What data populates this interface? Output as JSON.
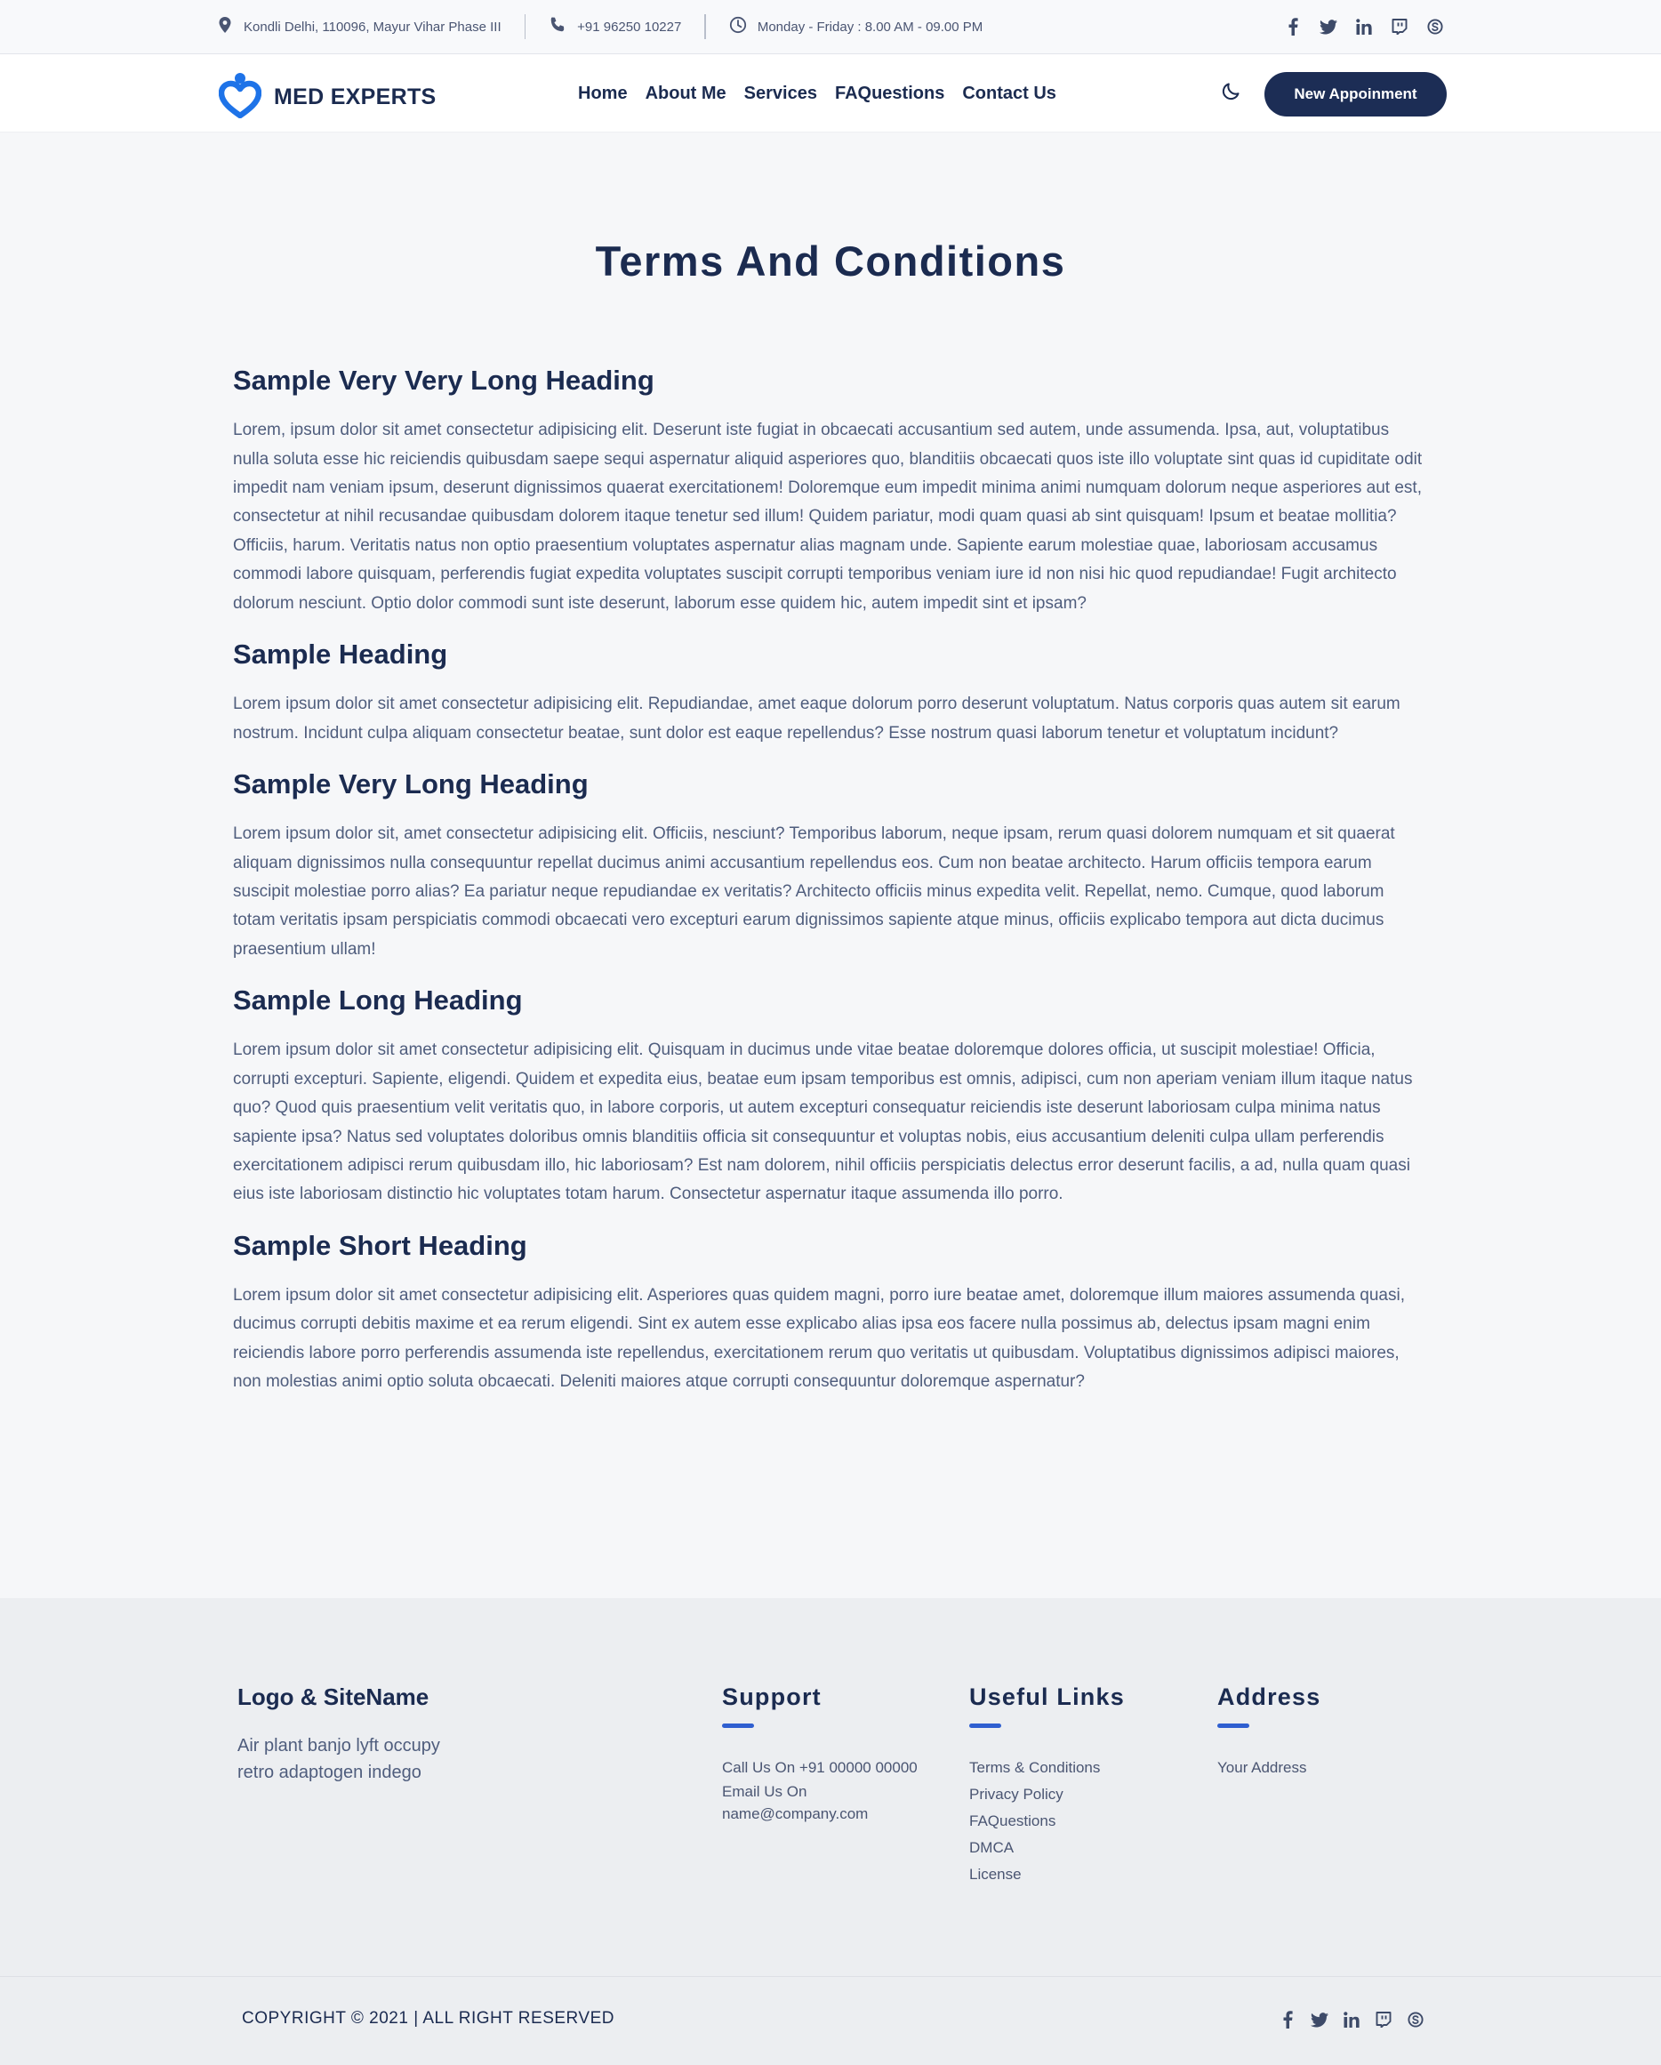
{
  "topbar": {
    "address": "Kondli Delhi, 110096, Mayur Vihar Phase III",
    "phone": "+91 96250 10227",
    "hours": "Monday - Friday : 8.00 AM - 09.00 PM",
    "socials": [
      "facebook-icon",
      "twitter-icon",
      "linkedin-icon",
      "twitch-icon",
      "skype-icon"
    ]
  },
  "navbar": {
    "logo_text": "MED EXPERTS",
    "links": [
      "Home",
      "About Me",
      "Services",
      "FAQuestions",
      "Contact Us"
    ],
    "cta_label": "New Appoinment",
    "theme_icon": "moon-icon"
  },
  "page": {
    "title": "Terms And Conditions",
    "sections": [
      {
        "heading": "Sample Very Very Long Heading",
        "body": "Lorem, ipsum dolor sit amet consectetur adipisicing elit. Deserunt iste fugiat in obcaecati accusantium sed autem, unde assumenda. Ipsa, aut, voluptatibus nulla soluta esse hic reiciendis quibusdam saepe sequi aspernatur aliquid asperiores quo, blanditiis obcaecati quos iste illo voluptate sint quas id cupiditate odit impedit nam veniam ipsum, deserunt dignissimos quaerat exercitationem! Doloremque eum impedit minima animi numquam dolorum neque asperiores aut est, consectetur at nihil recusandae quibusdam dolorem itaque tenetur sed illum! Quidem pariatur, modi quam quasi ab sint quisquam! Ipsum et beatae mollitia? Officiis, harum. Veritatis natus non optio praesentium voluptates aspernatur alias magnam unde. Sapiente earum molestiae quae, laboriosam accusamus commodi labore quisquam, perferendis fugiat expedita voluptates suscipit corrupti temporibus veniam iure id non nisi hic quod repudiandae! Fugit architecto dolorum nesciunt. Optio dolor commodi sunt iste deserunt, laborum esse quidem hic, autem impedit sint et ipsam?"
      },
      {
        "heading": "Sample Heading",
        "body": "Lorem ipsum dolor sit amet consectetur adipisicing elit. Repudiandae, amet eaque dolorum porro deserunt voluptatum. Natus corporis quas autem sit earum nostrum. Incidunt culpa aliquam consectetur beatae, sunt dolor est eaque repellendus? Esse nostrum quasi laborum tenetur et voluptatum incidunt?"
      },
      {
        "heading": "Sample Very Long Heading",
        "body": "Lorem ipsum dolor sit, amet consectetur adipisicing elit. Officiis, nesciunt? Temporibus laborum, neque ipsam, rerum quasi dolorem numquam et sit quaerat aliquam dignissimos nulla consequuntur repellat ducimus animi accusantium repellendus eos. Cum non beatae architecto. Harum officiis tempora earum suscipit molestiae porro alias? Ea pariatur neque repudiandae ex veritatis? Architecto officiis minus expedita velit. Repellat, nemo. Cumque, quod laborum totam veritatis ipsam perspiciatis commodi obcaecati vero excepturi earum dignissimos sapiente atque minus, officiis explicabo tempora aut dicta ducimus praesentium ullam!"
      },
      {
        "heading": "Sample Long Heading",
        "body": "Lorem ipsum dolor sit amet consectetur adipisicing elit. Quisquam in ducimus unde vitae beatae doloremque dolores officia, ut suscipit molestiae! Officia, corrupti excepturi. Sapiente, eligendi. Quidem et expedita eius, beatae eum ipsam temporibus est omnis, adipisci, cum non aperiam veniam illum itaque natus quo? Quod quis praesentium velit veritatis quo, in labore corporis, ut autem excepturi consequatur reiciendis iste deserunt laboriosam culpa minima natus sapiente ipsa? Natus sed voluptates doloribus omnis blanditiis officia sit consequuntur et voluptas nobis, eius accusantium deleniti culpa ullam perferendis exercitationem adipisci rerum quibusdam illo, hic laboriosam? Est nam dolorem, nihil officiis perspiciatis delectus error deserunt facilis, a ad, nulla quam quasi eius iste laboriosam distinctio hic voluptates totam harum. Consectetur aspernatur itaque assumenda illo porro."
      },
      {
        "heading": "Sample Short Heading",
        "body": "Lorem ipsum dolor sit amet consectetur adipisicing elit. Asperiores quas quidem magni, porro iure beatae amet, doloremque illum maiores assumenda quasi, ducimus corrupti debitis maxime et ea rerum eligendi. Sint ex autem esse explicabo alias ipsa eos facere nulla possimus ab, delectus ipsam magni enim reiciendis labore porro perferendis assumenda iste repellendus, exercitationem rerum quo veritatis ut quibusdam. Voluptatibus dignissimos adipisci maiores, non molestias animi optio soluta obcaecati. Deleniti maiores atque corrupti consequuntur doloremque aspernatur?"
      }
    ]
  },
  "footer": {
    "about_title": "Logo & SiteName",
    "about_text": "Air plant banjo lyft occupy retro adaptogen indego",
    "support_title": "Support",
    "support_lines": [
      "Call Us On +91 00000 00000",
      "Email Us On",
      "name@company.com"
    ],
    "links_title": "Useful Links",
    "links": [
      "Terms & Conditions",
      "Privacy Policy",
      "FAQuestions",
      "DMCA",
      "License"
    ],
    "address_title": "Address",
    "address": "Your Address",
    "copyright": "COPYRIGHT © 2021 | ALL RIGHT RESERVED"
  },
  "colors": {
    "navy": "#1c2d55",
    "accent": "#2f5fd0",
    "logo_blue": "#1e73e8"
  }
}
